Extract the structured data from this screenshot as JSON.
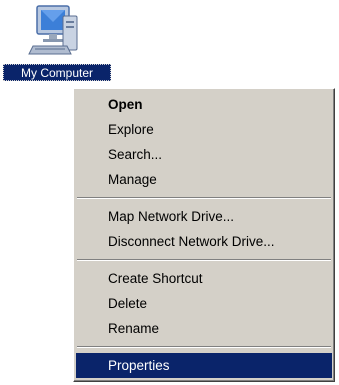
{
  "desktop": {
    "icon": {
      "label": "My Computer",
      "icon_name": "my-computer-icon"
    }
  },
  "context_menu": {
    "groups": [
      [
        {
          "label": "Open",
          "bold": true
        },
        {
          "label": "Explore"
        },
        {
          "label": "Search..."
        },
        {
          "label": "Manage"
        }
      ],
      [
        {
          "label": "Map Network Drive..."
        },
        {
          "label": "Disconnect Network Drive..."
        }
      ],
      [
        {
          "label": "Create Shortcut"
        },
        {
          "label": "Delete"
        },
        {
          "label": "Rename"
        }
      ],
      [
        {
          "label": "Properties",
          "highlighted": true
        }
      ]
    ]
  },
  "colors": {
    "selection": "#0a246a",
    "menu_face": "#d4d0c8"
  }
}
